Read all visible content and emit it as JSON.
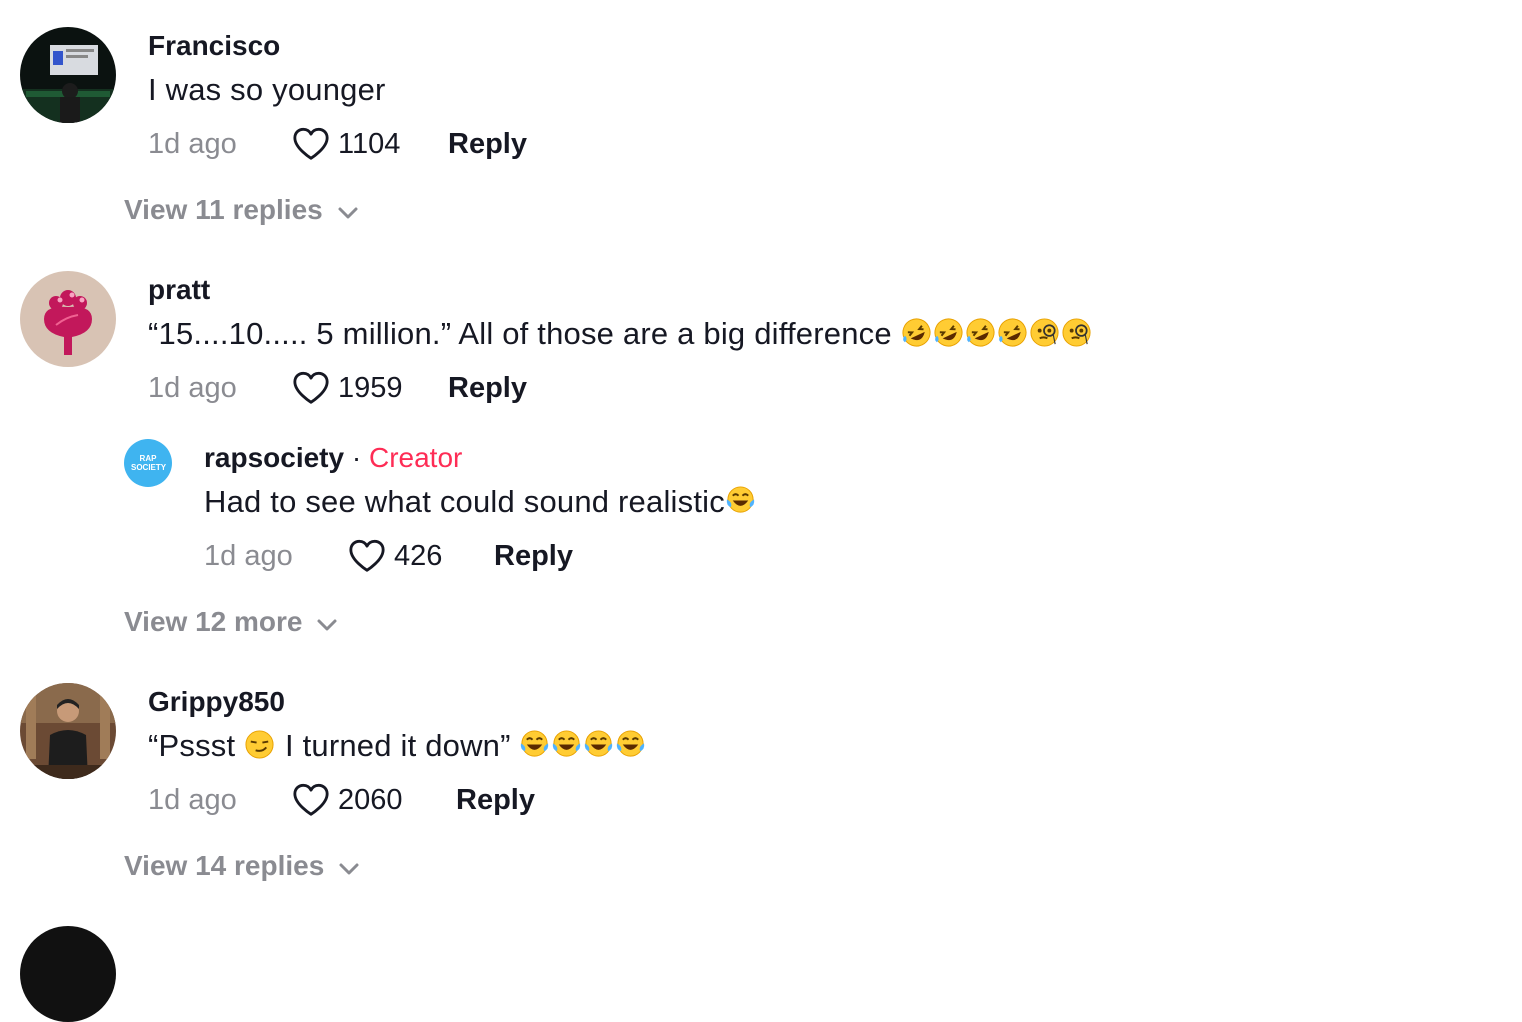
{
  "comments": [
    {
      "user": "Francisco",
      "text": "I was so younger",
      "time": "1d ago",
      "likes": "1104",
      "reply_label": "Reply",
      "view_replies": "View 11 replies"
    },
    {
      "user": "pratt",
      "text": "“15....10..... 5 million.” All of those are a big difference ",
      "emojis": [
        "rofl",
        "rofl",
        "rofl",
        "rofl",
        "monocle",
        "monocle"
      ],
      "time": "1d ago",
      "likes": "1959",
      "reply_label": "Reply",
      "replies": [
        {
          "user": "rapsociety",
          "separator": "·",
          "badge": "Creator",
          "avatar_text": "RAP SOCIETY",
          "text": "Had to see what could sound realistic",
          "emojis": [
            "joy"
          ],
          "time": "1d ago",
          "likes": "426",
          "reply_label": "Reply"
        }
      ],
      "view_replies": "View 12 more"
    },
    {
      "user": "Grippy850",
      "text_before": "“Pssst ",
      "text_after": " I turned it down” ",
      "emojis_inline": [
        "smirk"
      ],
      "emojis": [
        "joy",
        "joy",
        "joy",
        "joy"
      ],
      "time": "1d ago",
      "likes": "2060",
      "reply_label": "Reply",
      "view_replies": "View 14 replies"
    }
  ],
  "colors": {
    "creator_badge": "#fe2c55",
    "muted": "#8a8b91",
    "text": "#161823",
    "creator_avatar_bg": "#3fb4f0"
  },
  "icons": {
    "like": "heart-outline-icon",
    "expand": "chevron-down-icon"
  }
}
